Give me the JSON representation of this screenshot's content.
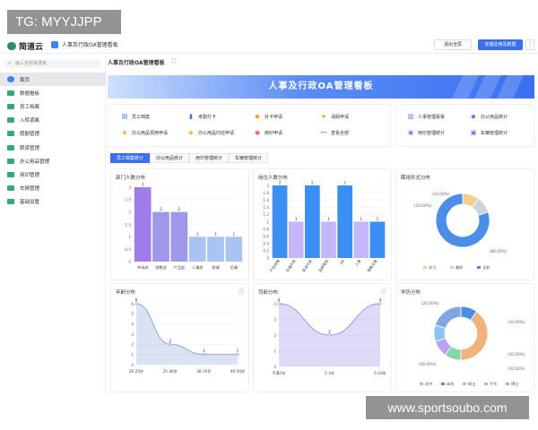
{
  "watermark_top": "TG: MYYJJPP",
  "watermark_bottom": "www.sportsoubo.com",
  "header": {
    "app_name": "简道云",
    "app_tab": "人事及行政OA管理看板",
    "exit_fullscreen": "退出全屏",
    "install_btn": "安装应用及数据",
    "more": "⋮"
  },
  "sidebar": {
    "search_placeholder": "输入名称来搜索",
    "items": [
      {
        "label": "首页",
        "icon": "home-icon",
        "active": true
      },
      {
        "label": "数据看板",
        "icon": "folder-icon"
      },
      {
        "label": "员工档案",
        "icon": "folder-icon"
      },
      {
        "label": "入转调离",
        "icon": "folder-icon"
      },
      {
        "label": "假勤管理",
        "icon": "folder-icon"
      },
      {
        "label": "薪资管理",
        "icon": "folder-icon"
      },
      {
        "label": "办公用品管理",
        "icon": "folder-icon"
      },
      {
        "label": "用印管理",
        "icon": "folder-icon"
      },
      {
        "label": "车辆管理",
        "icon": "folder-icon"
      },
      {
        "label": "基础设置",
        "icon": "folder-icon"
      }
    ]
  },
  "page": {
    "tab_title": "人事及行政OA管理看板",
    "expand_icon": "expand-icon"
  },
  "banner": {
    "title": "人事及行政OA管理看板"
  },
  "quick_left": [
    {
      "label": "员工档案",
      "icon": "id-card-icon",
      "color": "#3b6ff2",
      "glyph": "▤"
    },
    {
      "label": "考勤打卡",
      "icon": "bookmark-icon",
      "color": "#3b6ff2",
      "glyph": "▮"
    },
    {
      "label": "补卡申请",
      "icon": "tag-icon",
      "color": "#f59e0b",
      "glyph": "◆"
    },
    {
      "label": "请假申请",
      "icon": "send-icon",
      "color": "#f59e0b",
      "glyph": "➤"
    },
    {
      "label": "办公用品领用申请",
      "icon": "box-icon",
      "color": "#f59e0b",
      "glyph": "◈"
    },
    {
      "label": "办公用品归还申请",
      "icon": "box-icon",
      "color": "#f59e0b",
      "glyph": "◈"
    },
    {
      "label": "用印申请",
      "icon": "stamp-icon",
      "color": "#ef4444",
      "glyph": "◉"
    },
    {
      "label": "查看全部",
      "icon": "more-icon",
      "color": "#666666",
      "glyph": "⋯"
    }
  ],
  "quick_right": [
    {
      "label": "人事管理看板",
      "icon": "bar-chart-icon",
      "color": "#8b5cf6",
      "glyph": "▥"
    },
    {
      "label": "办公用品统计",
      "icon": "cube-icon",
      "color": "#8b5cf6",
      "glyph": "◆"
    },
    {
      "label": "用印管理统计",
      "icon": "stamp-icon",
      "color": "#8b5cf6",
      "glyph": "◉"
    },
    {
      "label": "车辆管理统计",
      "icon": "car-icon",
      "color": "#8b5cf6",
      "glyph": "▣"
    }
  ],
  "chart_tabs": [
    "员工档案统计",
    "办公用品统计",
    "用印管理统计",
    "车辆管理统计"
  ],
  "colors": {
    "accent": "#3b6ff2",
    "purple": "#a78bfa",
    "light_purple": "#c4b5fd",
    "blue_bar": "#3b8ef2",
    "donut_blue": "#4a8ee8",
    "yellow": "#f5cf89",
    "gray": "#cbd5e1",
    "green": "#86d6a8",
    "light_blue": "#8cc4f0",
    "violet": "#b9a3f0"
  },
  "chart_data": [
    {
      "id": "dept",
      "type": "bar",
      "title": "部门人数分布",
      "categories": [
        "市场部",
        "销售部",
        "产品部",
        "人事部",
        "前端",
        "后端"
      ],
      "values": [
        3,
        2,
        2,
        1,
        1,
        1
      ],
      "yticks": [
        0,
        0.5,
        1,
        1.5,
        2,
        2.5,
        3
      ],
      "ylim": [
        0,
        3
      ]
    },
    {
      "id": "position",
      "type": "bar",
      "title": "岗位人数分布",
      "categories": [
        "产品经理",
        "后端开发",
        "安卓开发",
        "品牌策划",
        "HR",
        "人事",
        "销售主管"
      ],
      "values": [
        2,
        1,
        2,
        1,
        2,
        1,
        1
      ],
      "yticks": [
        0,
        0.2,
        0.4,
        0.6,
        0.8,
        1,
        1.2,
        1.4,
        1.6,
        1.8,
        2
      ],
      "ylim": [
        0,
        2
      ]
    },
    {
      "id": "hire",
      "type": "pie",
      "title": "聘用形式分布",
      "slices": [
        {
          "name": "实习",
          "pct": "10.00%",
          "value": 10
        },
        {
          "name": "兼职",
          "pct": "10.00%",
          "value": 10
        },
        {
          "name": "全职",
          "pct": "80.00%",
          "value": 80
        }
      ],
      "labels": [
        "(10.00%)",
        "(10.00%)",
        "(80.00%)"
      ]
    },
    {
      "id": "age",
      "type": "area",
      "title": "年龄分布",
      "categories": [
        "26-25岁",
        "25-30岁",
        "30-35岁",
        "40-50岁"
      ],
      "values": [
        6,
        2,
        1,
        1
      ],
      "yticks": [
        0,
        1,
        2,
        3,
        4,
        5,
        6
      ],
      "ylim": [
        0,
        6
      ]
    },
    {
      "id": "tenure",
      "type": "area",
      "title": "司龄分布",
      "categories": [
        "不满1年",
        "1-3年",
        "5-10年"
      ],
      "values": [
        4,
        2,
        4
      ],
      "yticks": [
        0,
        1,
        2,
        3,
        4
      ],
      "ylim": [
        0,
        4
      ]
    },
    {
      "id": "edu",
      "type": "pie",
      "title": "学历分布",
      "slices": [
        {
          "name": "初中",
          "pct": "10.00%",
          "value": 10
        },
        {
          "name": "本科",
          "pct": "40.00%",
          "value": 40
        },
        {
          "name": "硕士",
          "pct": "10.00%",
          "value": 10
        },
        {
          "name": "大专",
          "pct": "10.00%",
          "value": 10
        },
        {
          "name": "博士",
          "pct": "10.00%",
          "value": 10
        },
        {
          "name": "",
          "pct": "20.00%",
          "value": 20
        }
      ],
      "labels": [
        "(20.00%)",
        "(10.00%)",
        "(10.00%)",
        "(10.00%)",
        "(40.00%)"
      ],
      "legend": [
        "初中",
        "本科",
        "硕士",
        "大专",
        "博士"
      ]
    }
  ]
}
